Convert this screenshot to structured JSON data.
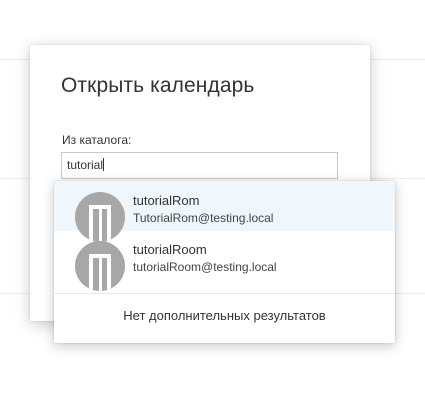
{
  "dialog": {
    "title": "Открыть календарь",
    "directory_label": "Из каталога:",
    "directory_input_value": "tutorial"
  },
  "suggestions": {
    "items": [
      {
        "name": "tutorialRom",
        "email": "TutorialRom@testing.local",
        "icon": "room-door-icon",
        "selected": true
      },
      {
        "name": "tutorialRoom",
        "email": "tutorialRoom@testing.local",
        "icon": "room-door-icon",
        "selected": false
      }
    ],
    "no_more_results": "Нет дополнительных результатов"
  },
  "colors": {
    "selected_row_bg": "#eff6fc",
    "avatar_bg": "#a7a7a7",
    "avatar_glyph": "#ffffff"
  }
}
